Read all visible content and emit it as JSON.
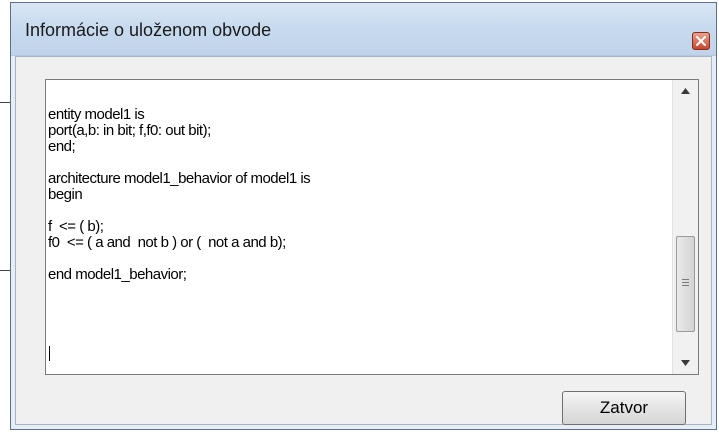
{
  "window": {
    "title": "Informácie o uloženom obvode",
    "close_icon": "close-icon"
  },
  "editor": {
    "lines": [
      "entity model1 is",
      "port(a,b: in bit; f,f0: out bit);",
      "end;",
      "",
      "architecture model1_behavior of model1 is",
      "begin",
      "",
      "f  <= ( b);",
      "f0  <= ( a and  not b ) or (  not a and b);",
      "",
      "end model1_behavior;"
    ]
  },
  "scrollbar": {
    "up_icon": "scroll-up-arrow-icon",
    "down_icon": "scroll-down-arrow-icon"
  },
  "footer": {
    "close_label": "Zatvor"
  },
  "colors": {
    "titlebar": "#c8dbef",
    "client": "#f0f0f0",
    "close_button": "#c4472e"
  }
}
